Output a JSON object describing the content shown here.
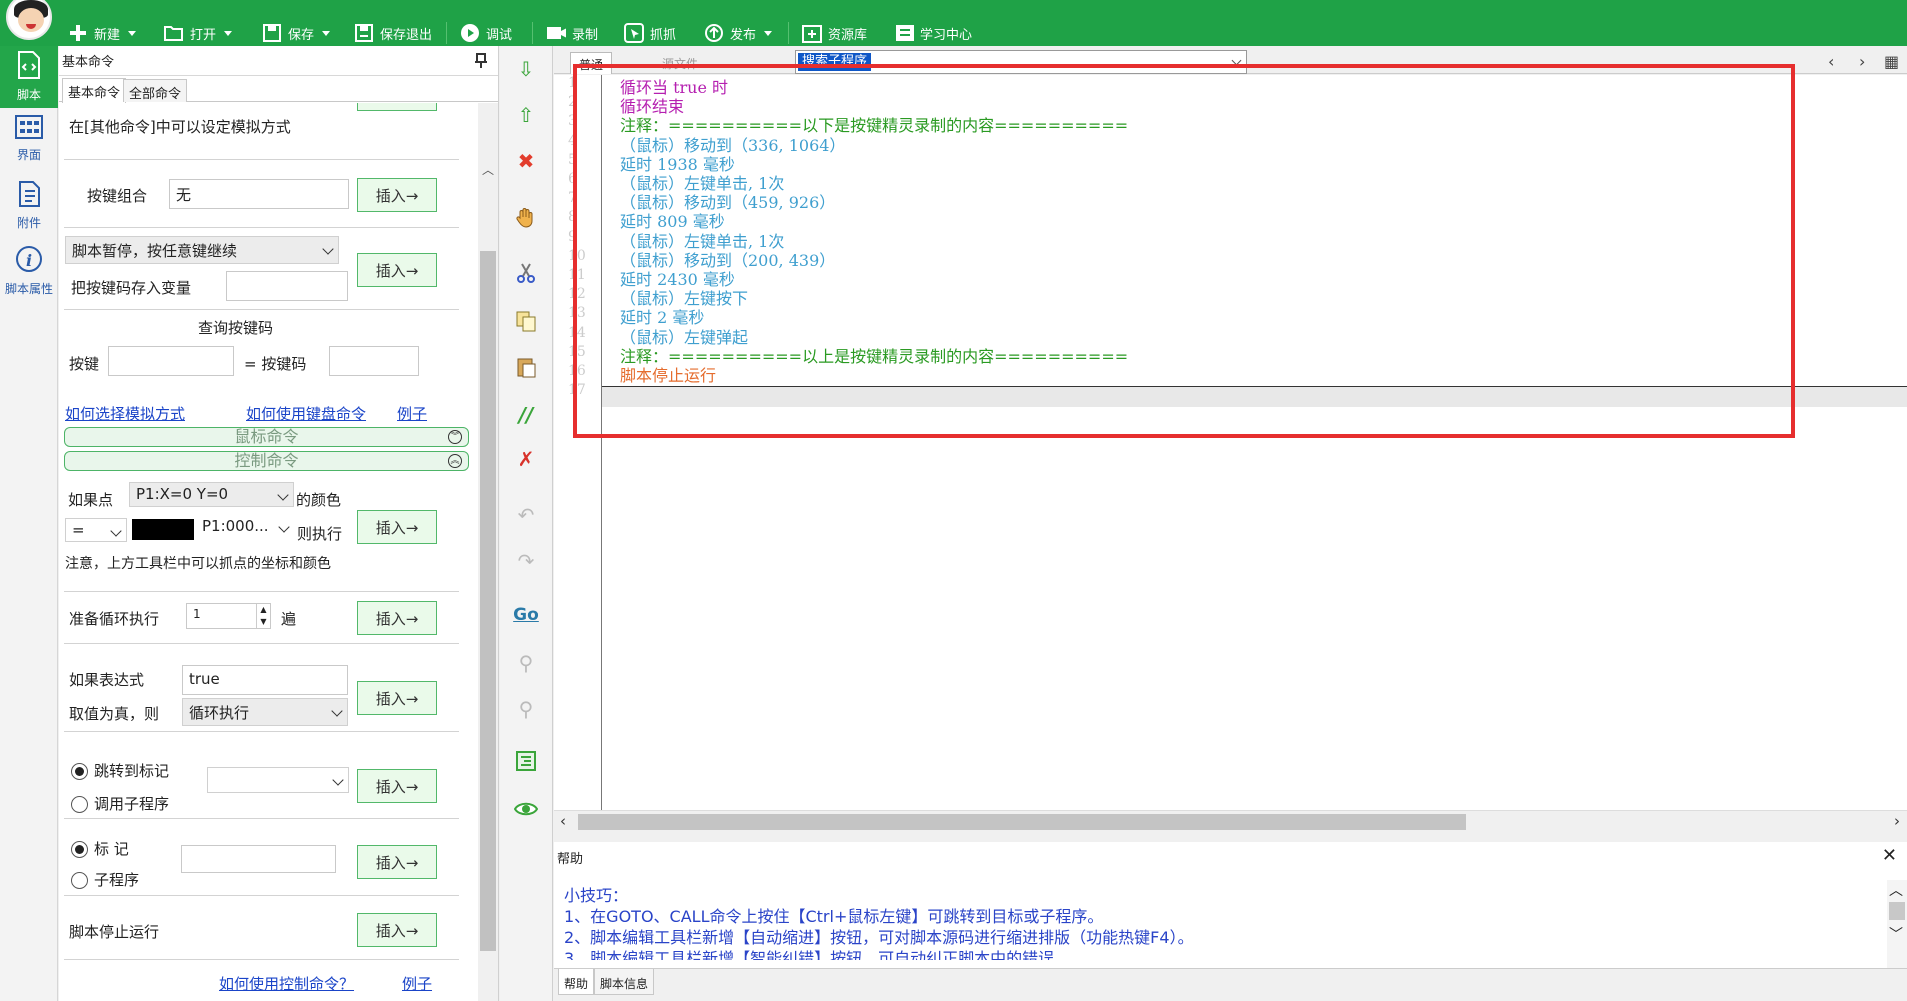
{
  "toolbar": {
    "new": "新建",
    "open": "打开",
    "save": "保存",
    "save_exit": "保存退出",
    "debug": "调试",
    "record": "录制",
    "capture": "抓抓",
    "publish": "发布",
    "resources": "资源库",
    "learning": "学习中心"
  },
  "leftnav": {
    "script": "脚本",
    "ui": "界面",
    "attachment": "附件",
    "properties": "脚本属性"
  },
  "panel": {
    "title": "基本命令",
    "tabs": [
      "基本命令",
      "全部命令"
    ],
    "hint_other": "在[其他命令]中可以设定模拟方式",
    "key_combo_label": "按键组合",
    "key_combo_value": "无",
    "insert": "插入→",
    "pause_select": "脚本暂停，按任意键继续",
    "save_key_var": "把按键码存入变量",
    "query_keycode": "查询按键码",
    "key_label": "按键",
    "eq_keycode": "= 按键码",
    "link_sim": "如何选择模拟方式",
    "link_kbd": "如何使用键盘命令",
    "link_example": "例子",
    "section_mouse": "鼠标命令",
    "section_control": "控制命令",
    "if_point": "如果点",
    "point_select": "P1:X=0 Y=0",
    "of_color": "的颜色",
    "op_select": "=",
    "color_select": "P1:000...",
    "then_exec": "则执行",
    "note": "注意，上方工具栏中可以抓点的坐标和颜色",
    "loop_label": "准备循环执行",
    "loop_value": "1",
    "loop_unit": "遍",
    "if_expr": "如果表达式",
    "expr_value": "true",
    "if_true_then": "取值为真，则",
    "true_action": "循环执行",
    "goto_label": "跳转到标记",
    "call_sub": "调用子程序",
    "mark_label": "标 记",
    "sub_label": "子程序",
    "stop_script": "脚本停止运行",
    "link_ctrl": "如何使用控制命令？",
    "link_example2": "例子"
  },
  "editor": {
    "tab_normal": "普通",
    "tab_source": "源文件",
    "search_text": "搜索子程序",
    "lines": [
      {
        "n": "1",
        "text": "循环当 true 时",
        "cls": "c-purple"
      },
      {
        "n": "2",
        "text": "循环结束",
        "cls": "c-purple"
      },
      {
        "n": "3",
        "text": "注释：==========以下是按键精灵录制的内容==========",
        "cls": "c-green"
      },
      {
        "n": "4",
        "text": "（鼠标）移动到（336, 1064）",
        "cls": "c-blue"
      },
      {
        "n": "5",
        "text": "延时 1938 毫秒",
        "cls": "c-blue"
      },
      {
        "n": "6",
        "text": "（鼠标）左键单击, 1次",
        "cls": "c-blue"
      },
      {
        "n": "7",
        "text": "（鼠标）移动到（459, 926）",
        "cls": "c-blue"
      },
      {
        "n": "8",
        "text": "延时 809 毫秒",
        "cls": "c-blue"
      },
      {
        "n": "9",
        "text": "（鼠标）左键单击, 1次",
        "cls": "c-blue"
      },
      {
        "n": "10",
        "text": "（鼠标）移动到（200, 439）",
        "cls": "c-blue"
      },
      {
        "n": "11",
        "text": "延时 2430 毫秒",
        "cls": "c-blue"
      },
      {
        "n": "12",
        "text": "（鼠标）左键按下",
        "cls": "c-blue"
      },
      {
        "n": "13",
        "text": "延时 2 毫秒",
        "cls": "c-blue"
      },
      {
        "n": "14",
        "text": "（鼠标）左键弹起",
        "cls": "c-blue"
      },
      {
        "n": "15",
        "text": "注释：==========以上是按键精灵录制的内容==========",
        "cls": "c-green"
      },
      {
        "n": "16",
        "text": "脚本停止运行",
        "cls": "c-orange"
      },
      {
        "n": "17",
        "text": "",
        "cls": ""
      }
    ]
  },
  "help": {
    "title": "帮助",
    "lines": [
      "小技巧：",
      "1、在GOTO、CALL命令上按住【Ctrl+鼠标左键】可跳转到目标或子程序。",
      "2、脚本编辑工具栏新增【自动缩进】按钮，可对脚本源码进行缩进排版（功能热键F4）。",
      "3、脚本编辑工具栏新增【智能纠错】按钮，可自动纠正脚本中的错误"
    ],
    "tabs": [
      "帮助",
      "脚本信息"
    ]
  },
  "colors": {
    "brand_green": "#1fa247",
    "highlight_red": "#e62e2e",
    "link_blue": "#1a44c8"
  }
}
